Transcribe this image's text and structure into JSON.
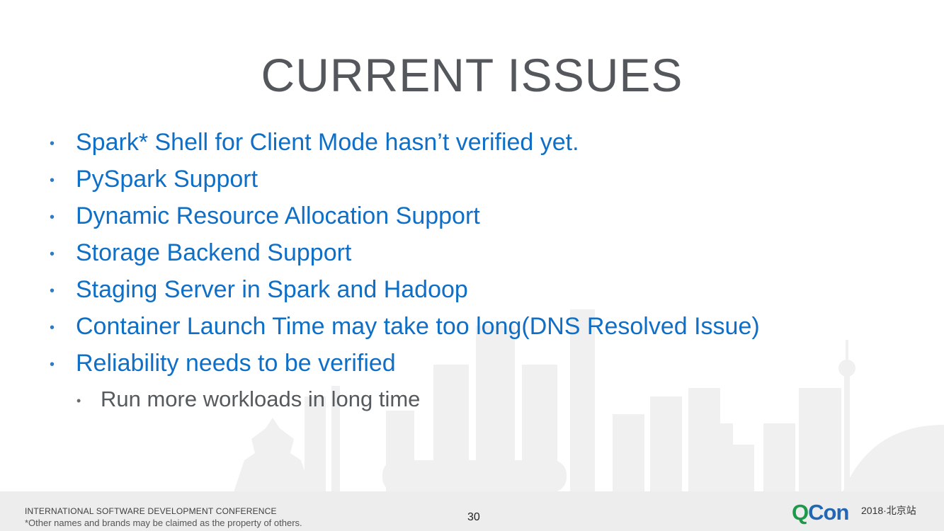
{
  "slide": {
    "title": "CURRENT ISSUES",
    "bullets": [
      "Spark* Shell for Client Mode hasn’t verified yet.",
      "PySpark Support",
      "Dynamic Resource Allocation Support",
      "Storage Backend Support",
      "Staging Server in Spark and Hadoop",
      "Container Launch Time may take too long(DNS Resolved Issue)",
      "Reliability needs to be verified"
    ],
    "sub_bullets": [
      "Run more workloads in long time"
    ]
  },
  "footer": {
    "conference": "INTERNATIONAL SOFTWARE DEVELOPMENT CONFERENCE",
    "disclaimer": "*Other names and brands may be claimed as the property of others.",
    "page_number": "30",
    "logo_q": "Q",
    "logo_con": "Con",
    "logo_sub": "2018·北京站"
  },
  "colors": {
    "title": "#54575b",
    "bullet_text": "#0f6fc6",
    "sub_bullet_text": "#555a5e",
    "footer_bg": "#ededed",
    "logo_green": "#1c9a4a",
    "logo_blue": "#2367b3"
  }
}
